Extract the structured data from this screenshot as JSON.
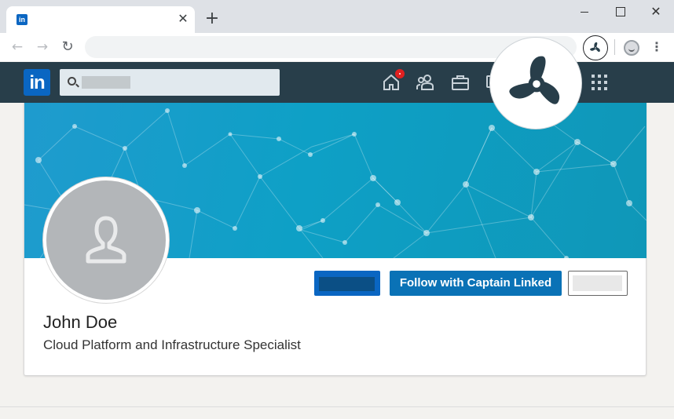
{
  "browser": {
    "tab": {
      "favicon_text": "in",
      "close_glyph": "✕"
    },
    "new_tab_glyph": "+",
    "window": {
      "close_glyph": "✕"
    },
    "toolbar": {
      "back_glyph": "←",
      "forward_glyph": "→",
      "reload_glyph": "↻",
      "menu_glyph": "⋮",
      "extension_icon": "propeller-icon"
    }
  },
  "linkedin": {
    "logo_text": "in",
    "nav_icons": [
      "home-icon",
      "network-icon",
      "jobs-icon",
      "messaging-icon",
      "apps-grid-icon"
    ],
    "notification_badge": true
  },
  "profile": {
    "name": "John Doe",
    "headline": "Cloud Platform and Infrastructure Specialist",
    "follow_button": "Follow with Captain Linked"
  },
  "colors": {
    "linkedin_header": "#283e4a",
    "linkedin_blue": "#0a66c2",
    "follow_button": "#0a72b6",
    "banner": "#0ea0c6"
  }
}
